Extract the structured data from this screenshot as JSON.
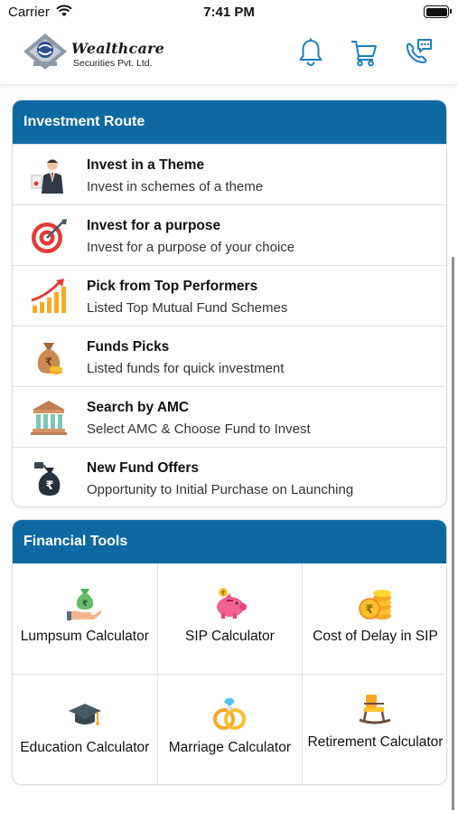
{
  "status_bar": {
    "carrier": "Carrier",
    "time": "7:41 PM"
  },
  "header": {
    "brand_name": "Wealthcare",
    "brand_sub": "Securities Pvt. Ltd.",
    "icons": [
      "bell-icon",
      "cart-icon",
      "support-chat-icon"
    ]
  },
  "investment_route": {
    "title": "Investment Route",
    "items": [
      {
        "title": "Invest in a Theme",
        "subtitle": "Invest in schemes of a theme",
        "icon": "businessman-icon"
      },
      {
        "title": "Invest for a purpose",
        "subtitle": "Invest for a purpose of your choice",
        "icon": "target-icon"
      },
      {
        "title": "Pick from Top Performers",
        "subtitle": "Listed Top Mutual Fund Schemes",
        "icon": "growth-chart-icon"
      },
      {
        "title": "Funds Picks",
        "subtitle": "Listed funds for quick investment",
        "icon": "money-bag-icon"
      },
      {
        "title": "Search by AMC",
        "subtitle": "Select AMC & Choose Fund to Invest",
        "icon": "bank-building-icon"
      },
      {
        "title": "New Fund Offers",
        "subtitle": "Opportunity to Initial Purchase on Launching",
        "icon": "rupee-bag-icon"
      }
    ]
  },
  "financial_tools": {
    "title": "Financial Tools",
    "items": [
      {
        "label": "Lumpsum Calculator",
        "icon": "hand-money-icon"
      },
      {
        "label": "SIP Calculator",
        "icon": "piggy-bank-icon"
      },
      {
        "label": "Cost of Delay in SIP",
        "icon": "coin-stack-icon"
      },
      {
        "label": "Education Calculator",
        "icon": "graduation-cap-icon"
      },
      {
        "label": "Marriage Calculator",
        "icon": "wedding-rings-icon"
      },
      {
        "label": "Retirement Calculator",
        "icon": "rocking-chair-icon"
      }
    ]
  },
  "colors": {
    "accent": "#0e69a3",
    "header_icon": "#1c7fbd"
  }
}
